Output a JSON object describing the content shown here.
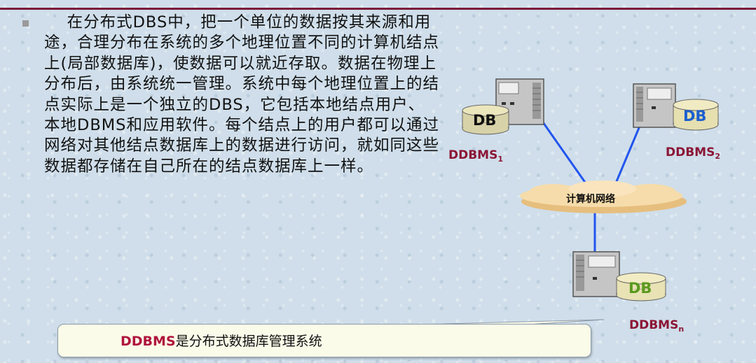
{
  "main_paragraph": "    在分布式DBS中，把一个单位的数据按其来源和用途，合理分布在系统的多个地理位置不同的计算机结点上(局部数据库)，使数据可以就近存取。数据在物理上分布后，由系统统一管理。系统中每个地理位置上的结点实际上是一个独立的DBS，它包括本地结点用户、本地DBMS和应用软件。每个结点上的用户都可以通过网络对其他结点数据库上的数据进行访问，就如同这些数据都存储在自己所在的结点数据库上一样。",
  "diagram": {
    "network_label": "计算机网络",
    "nodes": [
      {
        "name": "DDBMS",
        "sub": "1",
        "db_label": "DB",
        "db_color": "#111111",
        "db_fill": "#d8d2a8"
      },
      {
        "name": "DDBMS",
        "sub": "2",
        "db_label": "DB",
        "db_color": "#1a5fd0",
        "db_fill": "#e6dfb0"
      },
      {
        "name": "DDBMS",
        "sub": "n",
        "db_label": "DB",
        "db_color": "#5a9a1e",
        "db_fill": "#e8e2b4"
      }
    ]
  },
  "callout": {
    "term": "DDBMS",
    "definition": "是分布式数据库管理系统"
  },
  "colors": {
    "accent": "#8b1535",
    "link_line": "#2255ee",
    "cloud": "#f5d9a6"
  }
}
